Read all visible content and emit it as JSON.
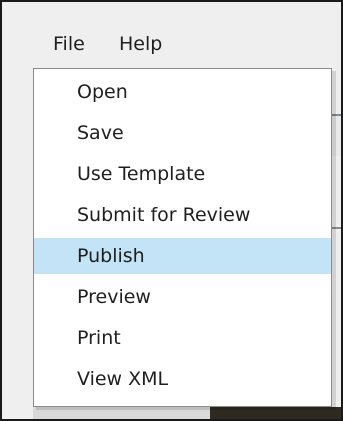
{
  "menubar": {
    "items": [
      {
        "label": "File"
      },
      {
        "label": "Help"
      }
    ]
  },
  "file_menu": {
    "items": [
      {
        "label": "Open",
        "highlighted": false
      },
      {
        "label": "Save",
        "highlighted": false
      },
      {
        "label": "Use Template",
        "highlighted": false
      },
      {
        "label": "Submit for Review",
        "highlighted": false
      },
      {
        "label": "Publish",
        "highlighted": true
      },
      {
        "label": "Preview",
        "highlighted": false
      },
      {
        "label": "Print",
        "highlighted": false
      },
      {
        "label": "View XML",
        "highlighted": false
      }
    ]
  },
  "colors": {
    "highlight": "#c3e3f7",
    "menubar_background": "#efefef",
    "dropdown_background": "#ffffff",
    "text": "#1f1f1f"
  }
}
